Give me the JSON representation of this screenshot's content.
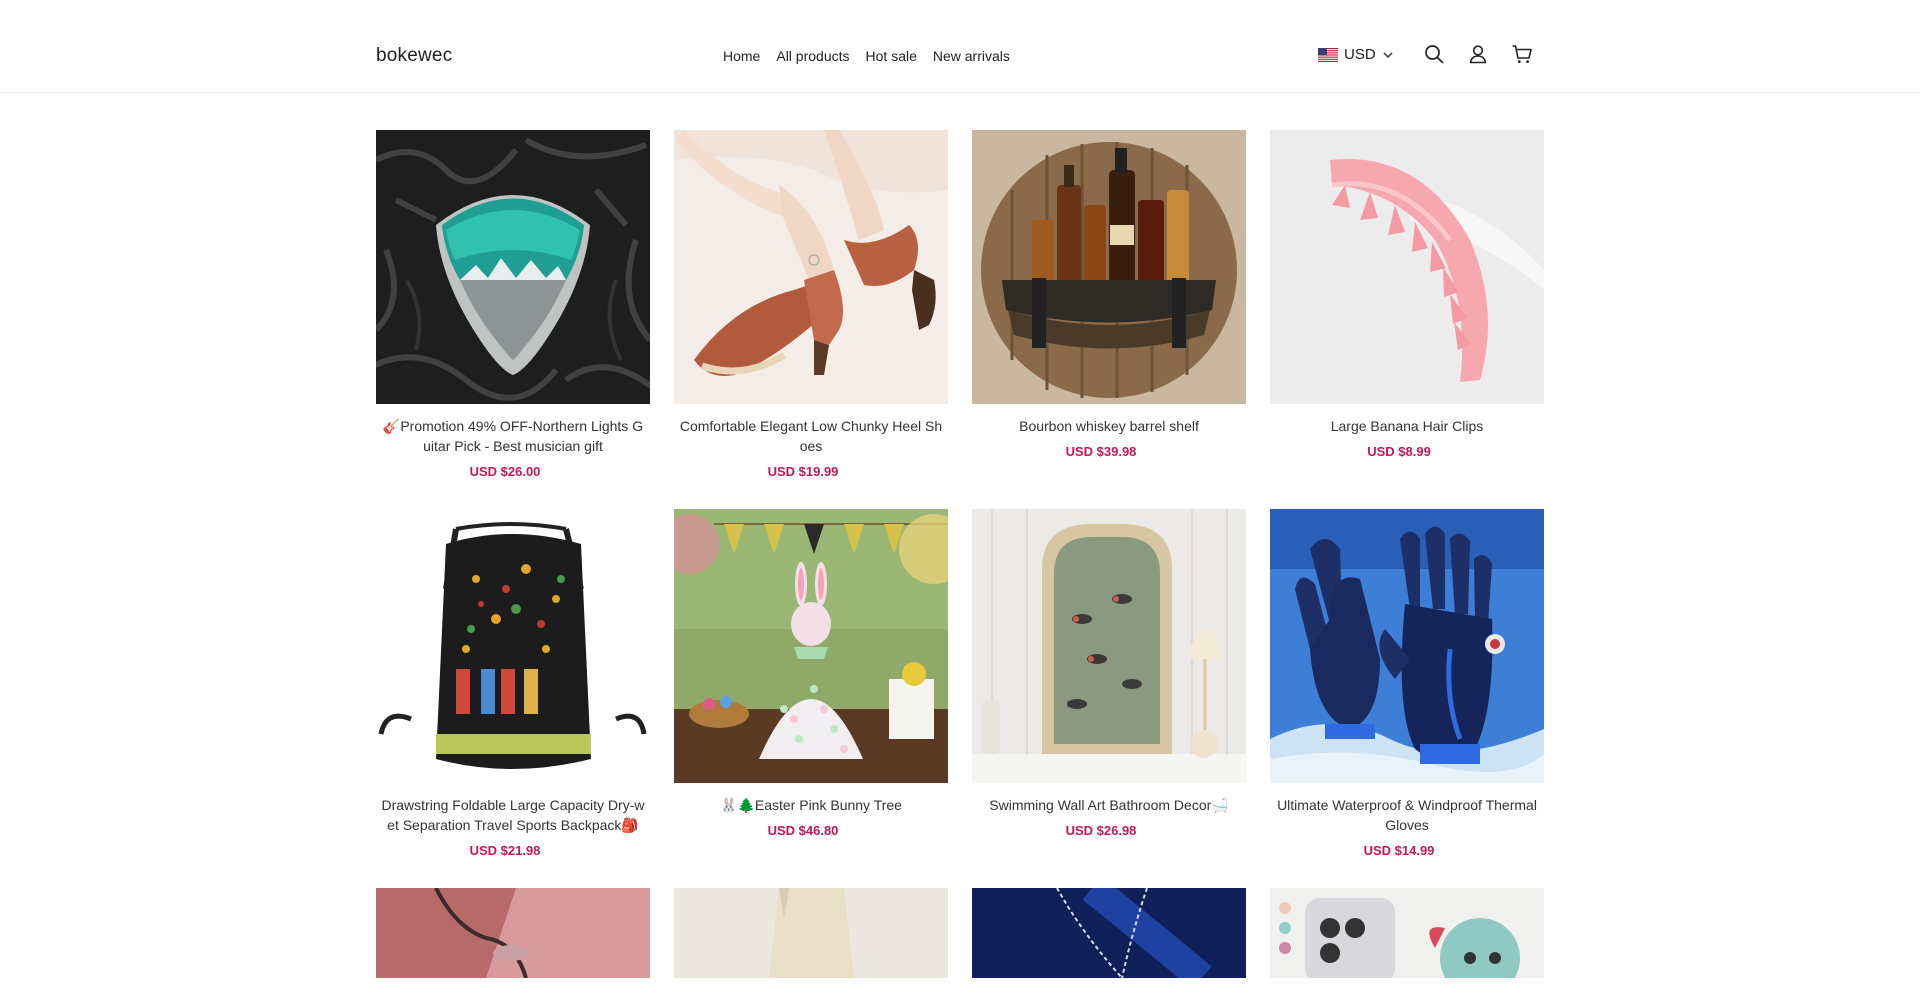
{
  "header": {
    "logo": "bokewec",
    "nav": [
      "Home",
      "All products",
      "Hot sale",
      "New arrivals"
    ],
    "currency": "USD"
  },
  "products": [
    {
      "name": "🎸Promotion 49% OFF-Northern Lights Guitar Pick - Best musician gift",
      "price": "USD $26.00"
    },
    {
      "name": "Comfortable Elegant Low Chunky Heel Shoes",
      "price": "USD $19.99"
    },
    {
      "name": "Bourbon whiskey barrel shelf",
      "price": "USD $39.98"
    },
    {
      "name": "Large Banana Hair Clips",
      "price": "USD $8.99"
    },
    {
      "name": "Drawstring Foldable Large Capacity Dry-wet Separation Travel Sports Backpack🎒",
      "price": "USD $21.98"
    },
    {
      "name": "🐰🌲Easter Pink Bunny Tree",
      "price": "USD $46.80"
    },
    {
      "name": "Swimming Wall Art Bathroom Decor🛁",
      "price": "USD $26.98"
    },
    {
      "name": "Ultimate Waterproof & Windproof Thermal Gloves",
      "price": "USD $14.99"
    }
  ],
  "colors": {
    "price": "#c2185b",
    "text": "#222222",
    "border": "#ececec"
  }
}
